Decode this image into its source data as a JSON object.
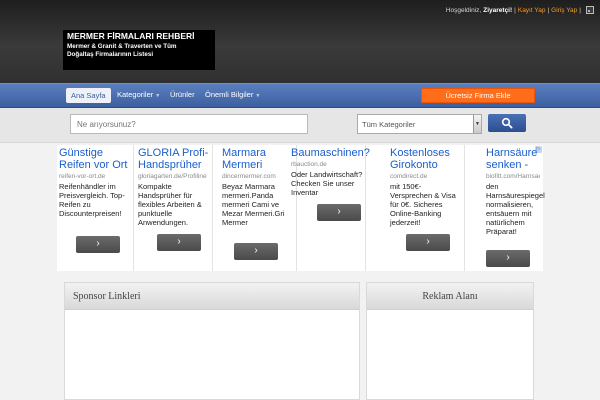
{
  "topbar": {
    "greeting": "Hoşgeldiniz,",
    "user": "Ziyaretçi!",
    "sep1": "|",
    "register": "Kayıt Yap",
    "sep2": "|",
    "login": "Giriş Yap",
    "sep3": "|",
    "rss_icon": "rss-icon"
  },
  "logo": {
    "line1": "MERMER FİRMALARI REHBERİ",
    "line2": "Mermer & Granit & Traverten ve Tüm",
    "line3": "Doğaltaş Firmalarının Listesi"
  },
  "nav": {
    "items": [
      {
        "label": "Ana Sayfa"
      },
      {
        "label": "Kategoriler"
      },
      {
        "label": "Ürünler"
      },
      {
        "label": "Önemli Bilgiler"
      }
    ],
    "cta": "Ücretsiz Firma Ekle"
  },
  "search": {
    "placeholder": "Ne arıyorsunuz?",
    "category": "Tüm Kategoriler",
    "search_icon": "search-icon"
  },
  "ads": [
    {
      "title": "Günstige Reifen vor Ort",
      "url": "reifen-vor-ort.de",
      "desc": "Reifenhändler im Preisvergleich. Top-Reifen zu Discounterpreisen!",
      "btn": "›"
    },
    {
      "title": "GLORIA Profi-Handsprüher",
      "url": "gloriagarten.de/Profiline",
      "desc": "Kompakte Handsprüher für flexibles Arbeiten & punktuelle Anwendungen.",
      "btn": "›"
    },
    {
      "title": "Marmara Mermeri",
      "url": "dincermermer.com",
      "desc": "Beyaz Marmara mermeri.Panda mermeri Cami ve Mezar Mermeri.Gri Mermer",
      "btn": "›"
    },
    {
      "title": "Baumaschinen?",
      "url": "rbauction.de",
      "desc": "Oder Landwirtschaft? Checken Sie unser Inventar",
      "btn": "›"
    },
    {
      "title": "Kostenloses Girokonto",
      "url": "comdirect.de",
      "desc": "mit 150€-Versprechen & Visa für 0€. Sicheres Online-Banking jederzeit!",
      "btn": "›"
    },
    {
      "title": "Harnsäure senken -",
      "url": "biofitt.com/Harnsaeu...",
      "desc": "den Harnsäurespiegel normalisieren, entsäuern mit natürlichem Präparat!",
      "btn": "›"
    }
  ],
  "panels": {
    "sponsor": "Sponsor Linkleri",
    "reklam": "Reklam Alanı"
  }
}
